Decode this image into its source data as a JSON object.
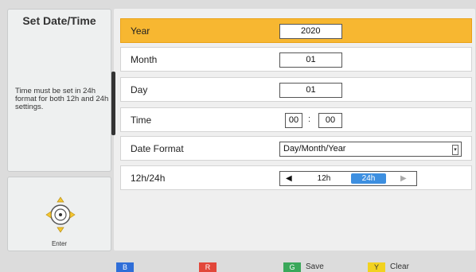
{
  "sidebar": {
    "title": "Set Date/Time",
    "description": "Time must be set in 24h format for both 12h and 24h settings.",
    "enter_label": "Enter"
  },
  "form": {
    "year": {
      "label": "Year",
      "value": "2020"
    },
    "month": {
      "label": "Month",
      "value": "01"
    },
    "day": {
      "label": "Day",
      "value": "01"
    },
    "time": {
      "label": "Time",
      "hour": "00",
      "separator": ":",
      "minute": "00"
    },
    "date_format": {
      "label": "Date Format",
      "value": "Day/Month/Year"
    },
    "hour_mode": {
      "label": "12h/24h",
      "options": [
        "12h",
        "24h"
      ],
      "selected": "24h"
    }
  },
  "footer": {
    "keys": [
      {
        "key": "B",
        "label": "",
        "color": "#2f6ed8"
      },
      {
        "key": "R",
        "label": "",
        "color": "#e2473a"
      },
      {
        "key": "G",
        "label": "Save",
        "color": "#3aa85a"
      },
      {
        "key": "Y",
        "label": "Clear",
        "color": "#f2d21f"
      }
    ]
  },
  "colors": {
    "selected_row": "#f7b731",
    "toggle_active": "#3d8fe0"
  }
}
